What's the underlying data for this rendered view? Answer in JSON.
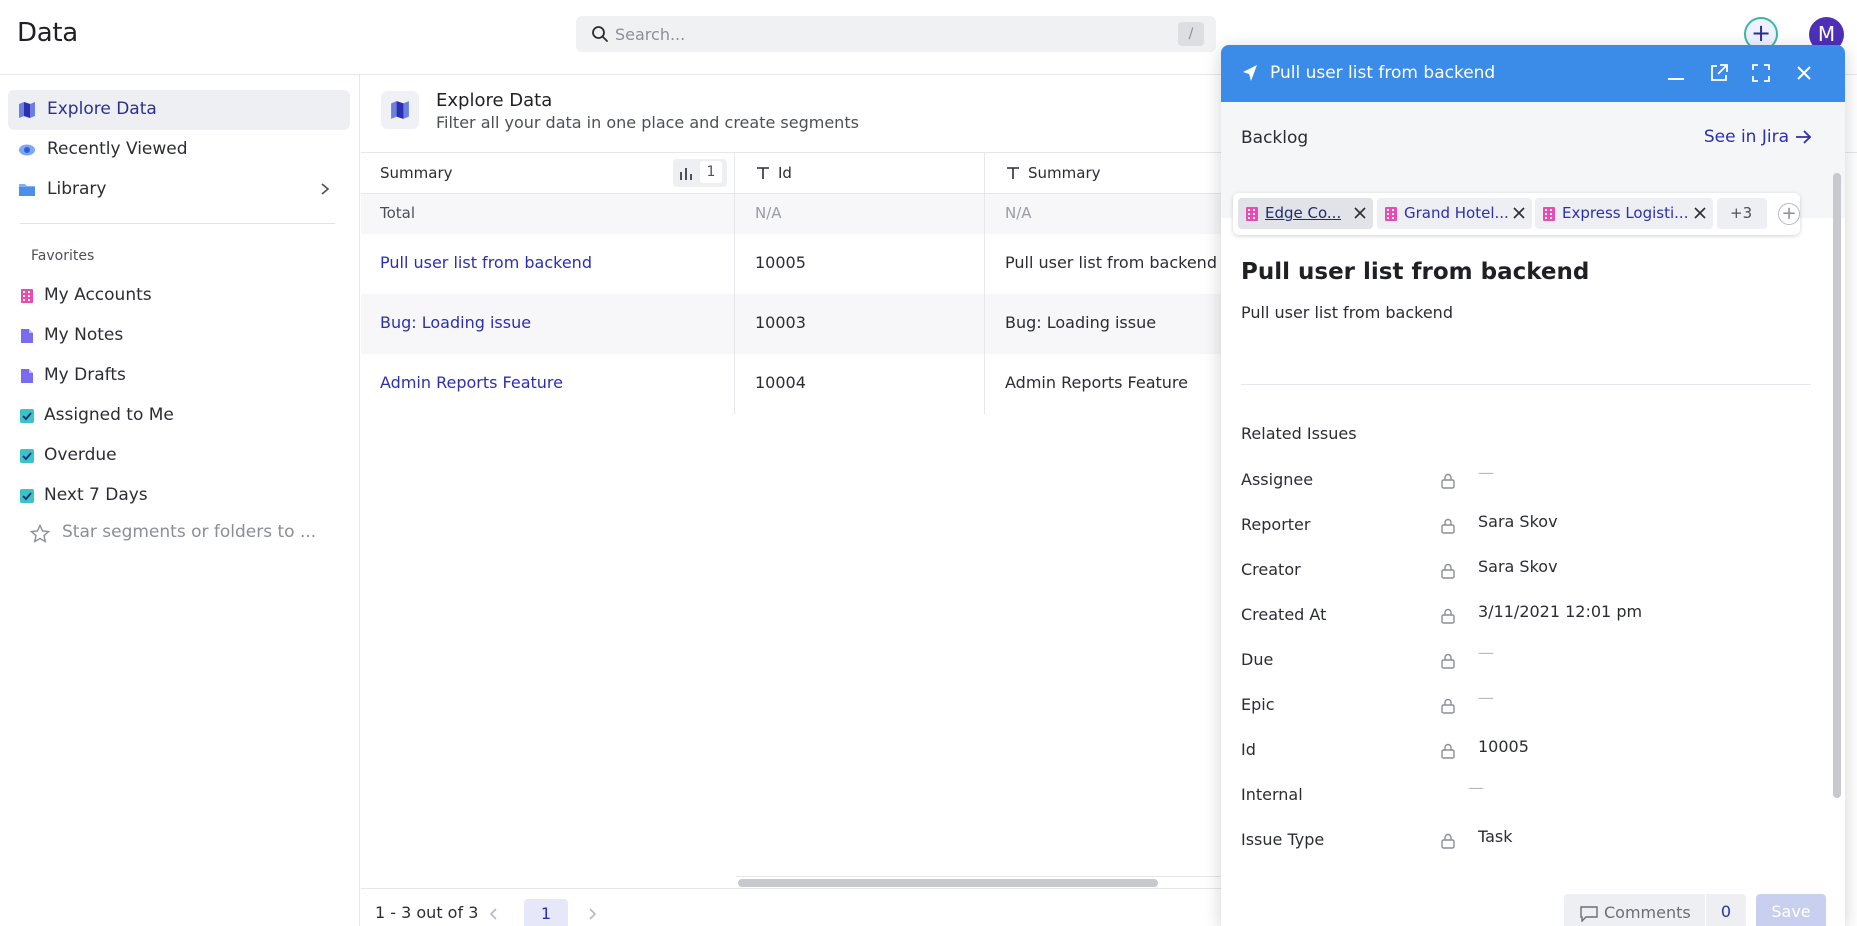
{
  "app": {
    "title": "Data",
    "avatar_initial": "M"
  },
  "search": {
    "placeholder": "Search...",
    "shortcut": "/"
  },
  "sidebar": {
    "nav": [
      {
        "label": "Explore Data",
        "icon": "map-icon",
        "active": true
      },
      {
        "label": "Recently Viewed",
        "icon": "eye-icon"
      },
      {
        "label": "Library",
        "icon": "folder-icon"
      }
    ],
    "favorites_heading": "Favorites",
    "favorites": [
      {
        "label": "My Accounts",
        "icon": "building-icon"
      },
      {
        "label": "My Notes",
        "icon": "note-icon"
      },
      {
        "label": "My Drafts",
        "icon": "note-icon"
      },
      {
        "label": "Assigned to Me",
        "icon": "checkbox-icon"
      },
      {
        "label": "Overdue",
        "icon": "checkbox-icon"
      },
      {
        "label": "Next 7 Days",
        "icon": "checkbox-icon"
      }
    ],
    "star_hint": "Star segments or folders to ..."
  },
  "explore": {
    "title": "Explore Data",
    "subtitle": "Filter all your data in one place and create segments"
  },
  "table": {
    "columns": [
      "Summary",
      "Id",
      "Summary"
    ],
    "sort_count": "1",
    "total": {
      "label": "Total",
      "id": "N/A",
      "summary": "N/A"
    },
    "rows": [
      {
        "summary_link": "Pull user list from backend",
        "id": "10005",
        "summary": "Pull user list from backend"
      },
      {
        "summary_link": "Bug: Loading issue",
        "id": "10003",
        "summary": "Bug: Loading issue"
      },
      {
        "summary_link": "Admin Reports Feature",
        "id": "10004",
        "summary": "Admin Reports Feature"
      }
    ],
    "pagination": {
      "range": "1 - 3 out of 3",
      "page": "1"
    }
  },
  "panel": {
    "header_title": "Pull user list from backend",
    "status": "Backlog",
    "see_in_jira": "See in Jira",
    "tags": [
      "Edge Co...",
      "Grand Hotel...",
      "Express Logisti..."
    ],
    "more_tags": "+3",
    "issue_title": "Pull user list from backend",
    "issue_description": "Pull user list from backend",
    "related_issues_label": "Related Issues",
    "fields": [
      {
        "label": "Assignee",
        "value": "—"
      },
      {
        "label": "Reporter",
        "value": "Sara Skov"
      },
      {
        "label": "Creator",
        "value": "Sara Skov"
      },
      {
        "label": "Created At",
        "value": "3/11/2021 12:01 pm"
      },
      {
        "label": "Due",
        "value": "—"
      },
      {
        "label": "Epic",
        "value": "—"
      },
      {
        "label": "Id",
        "value": "10005"
      },
      {
        "label": "Internal",
        "value": "—"
      },
      {
        "label": "Issue Type",
        "value": "Task"
      }
    ],
    "comments_label": "Comments",
    "comments_count": "0",
    "save_label": "Save"
  },
  "colors": {
    "accent": "#2c2fb0",
    "panel_header": "#3b8be8",
    "avatar": "#4d2fb8",
    "tag_icon": "#d63fa3",
    "check_icon": "#38c4c9"
  }
}
